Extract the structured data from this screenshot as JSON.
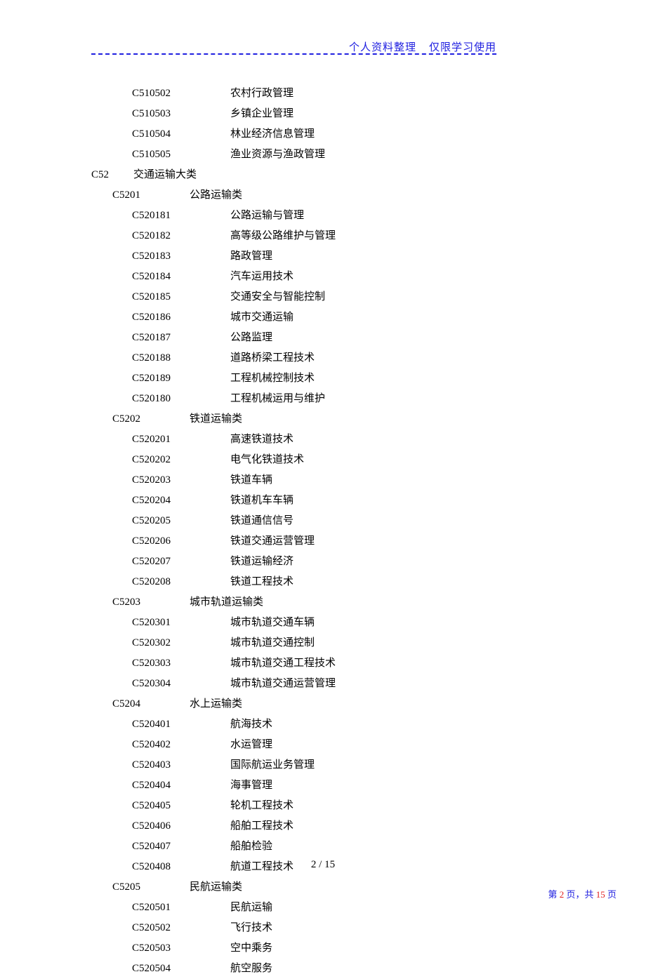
{
  "header": {
    "left": "个人资料整理",
    "right": "仅限学习使用"
  },
  "prelist": [
    {
      "code": "C510502",
      "name": "农村行政管理"
    },
    {
      "code": "C510503",
      "name": "乡镇企业管理"
    },
    {
      "code": "C510504",
      "name": "林业经济信息管理"
    },
    {
      "code": "C510505",
      "name": "渔业资源与渔政管理"
    }
  ],
  "top": {
    "code": "C52",
    "name": "交通运输大类"
  },
  "groups": [
    {
      "code": "C5201",
      "name": "公路运输类",
      "items": [
        {
          "code": "C520181",
          "name": "公路运输与管理"
        },
        {
          "code": "C520182",
          "name": "高等级公路维护与管理"
        },
        {
          "code": "C520183",
          "name": "路政管理"
        },
        {
          "code": "C520184",
          "name": "汽车运用技术"
        },
        {
          "code": "C520185",
          "name": "交通安全与智能控制"
        },
        {
          "code": "C520186",
          "name": "城市交通运输"
        },
        {
          "code": "C520187",
          "name": "公路监理"
        },
        {
          "code": "C520188",
          "name": "道路桥梁工程技术"
        },
        {
          "code": "C520189",
          "name": "工程机械控制技术"
        },
        {
          "code": "C520180",
          "name": "工程机械运用与维护"
        }
      ]
    },
    {
      "code": "C5202",
      "name": "铁道运输类",
      "items": [
        {
          "code": "C520201",
          "name": "高速铁道技术"
        },
        {
          "code": "C520202",
          "name": "电气化铁道技术"
        },
        {
          "code": "C520203",
          "name": "铁道车辆"
        },
        {
          "code": "C520204",
          "name": "铁道机车车辆"
        },
        {
          "code": "C520205",
          "name": "铁道通信信号"
        },
        {
          "code": "C520206",
          "name": "铁道交通运营管理"
        },
        {
          "code": "C520207",
          "name": "铁道运输经济"
        },
        {
          "code": "C520208",
          "name": "铁道工程技术"
        }
      ]
    },
    {
      "code": "C5203",
      "name": "城市轨道运输类",
      "items": [
        {
          "code": "C520301",
          "name": "城市轨道交通车辆"
        },
        {
          "code": "C520302",
          "name": "城市轨道交通控制"
        },
        {
          "code": "C520303",
          "name": "城市轨道交通工程技术"
        },
        {
          "code": "C520304",
          "name": "城市轨道交通运营管理"
        }
      ]
    },
    {
      "code": "C5204",
      "name": "水上运输类",
      "items": [
        {
          "code": "C520401",
          "name": "航海技术"
        },
        {
          "code": "C520402",
          "name": "水运管理"
        },
        {
          "code": "C520403",
          "name": "国际航运业务管理"
        },
        {
          "code": "C520404",
          "name": "海事管理"
        },
        {
          "code": "C520405",
          "name": "轮机工程技术"
        },
        {
          "code": "C520406",
          "name": "船舶工程技术"
        },
        {
          "code": "C520407",
          "name": "船舶检验"
        },
        {
          "code": "C520408",
          "name": "航道工程技术"
        }
      ]
    },
    {
      "code": "C5205",
      "name": "民航运输类",
      "items": [
        {
          "code": "C520501",
          "name": "民航运输"
        },
        {
          "code": "C520502",
          "name": "飞行技术"
        },
        {
          "code": "C520503",
          "name": "空中乘务"
        },
        {
          "code": "C520504",
          "name": "航空服务"
        }
      ]
    }
  ],
  "pagenum": {
    "cur": "2",
    "sep": " / ",
    "total": "15"
  },
  "corner": {
    "t1": "第 ",
    "n1": "2",
    "t2": " 页，共 ",
    "n2": "15",
    "t3": " 页"
  }
}
